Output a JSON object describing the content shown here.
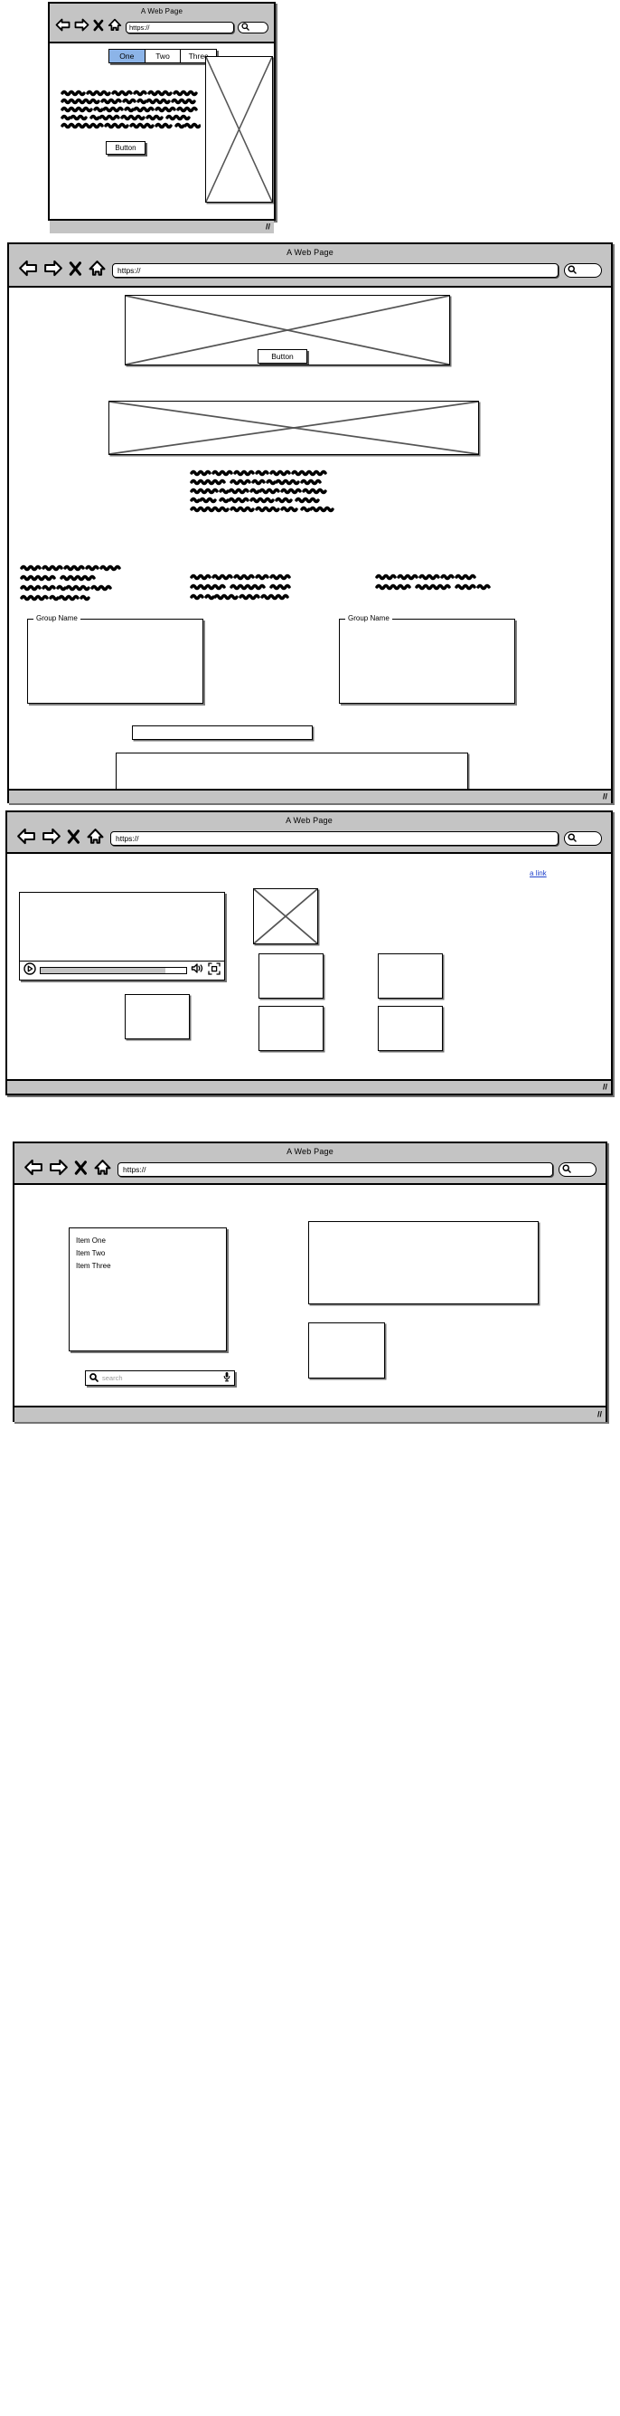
{
  "common": {
    "window_title": "A Web Page",
    "url_value": "https://",
    "nav": {
      "back": "back-arrow",
      "forward": "forward-arrow",
      "stop": "close-x",
      "home": "home",
      "search": "search-magnifier"
    },
    "resize_grip": "//"
  },
  "window1": {
    "title": "A Web Page",
    "url": "https://",
    "tabs": [
      {
        "label": "One",
        "active": true
      },
      {
        "label": "Two",
        "active": false
      },
      {
        "label": "Three",
        "active": false
      }
    ],
    "button_label": "Button",
    "paragraph_lines": 5,
    "image_placeholder": "image-placeholder"
  },
  "window2": {
    "title": "A Web Page",
    "url": "https://",
    "button_label": "Button",
    "hero_image": "image-placeholder",
    "banner_image": "image-placeholder",
    "paragraph_lines": 5,
    "columns": [
      {
        "lines": 4
      },
      {
        "lines": 3
      },
      {
        "lines": 2
      }
    ],
    "groups": [
      {
        "label": "Group Name"
      },
      {
        "label": "Group Name"
      }
    ],
    "field_box": "input-field",
    "content_panel": "content-panel"
  },
  "window3": {
    "title": "A Web Page",
    "url": "https://",
    "link_label": "a link",
    "video": {
      "play": "play-icon",
      "volume": "volume-icon",
      "fullscreen": "fullscreen-icon",
      "progress_percent": 86
    },
    "image_placeholder": "image-placeholder",
    "thumbnails": 5
  },
  "window4": {
    "title": "A Web Page",
    "url": "https://",
    "list_items": [
      "Item One",
      "Item Two",
      "Item Three"
    ],
    "search": {
      "placeholder": "search",
      "icon": "search-magnifier",
      "mic_icon": "microphone-icon"
    },
    "panels": 2
  },
  "colors": {
    "chrome_gray": "#c4c4c4",
    "tab_active_blue": "#8cb4e8",
    "link_blue": "#2244cc",
    "placeholder_gray": "#9a9a9a",
    "stroke": "#000000"
  }
}
